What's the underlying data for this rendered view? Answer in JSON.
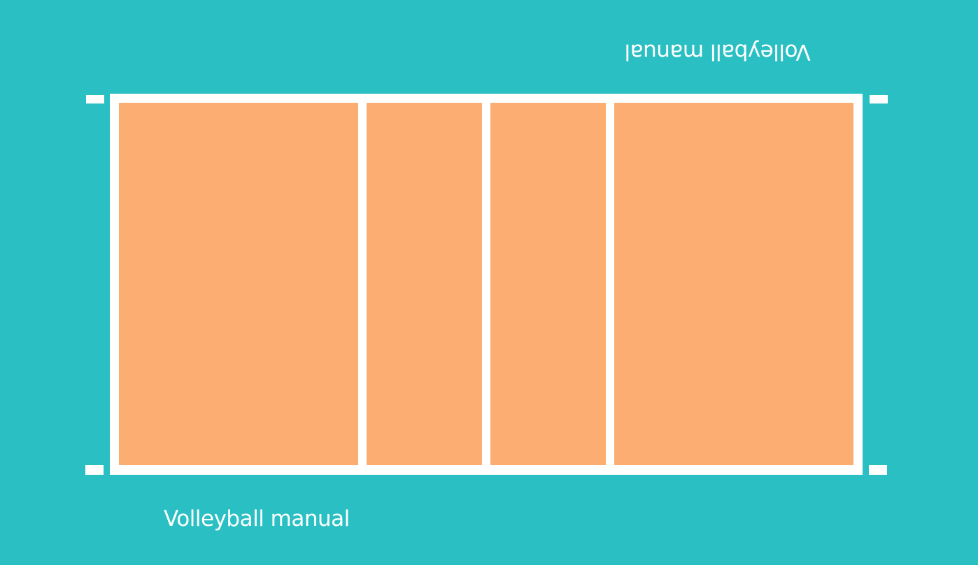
{
  "colors": {
    "background": "#2ac0c3",
    "court": "#fbad72",
    "lines": "#ffffff"
  },
  "labels": {
    "bottom_caption": "Volleyball manual",
    "top_caption": "Volleyball manual"
  }
}
